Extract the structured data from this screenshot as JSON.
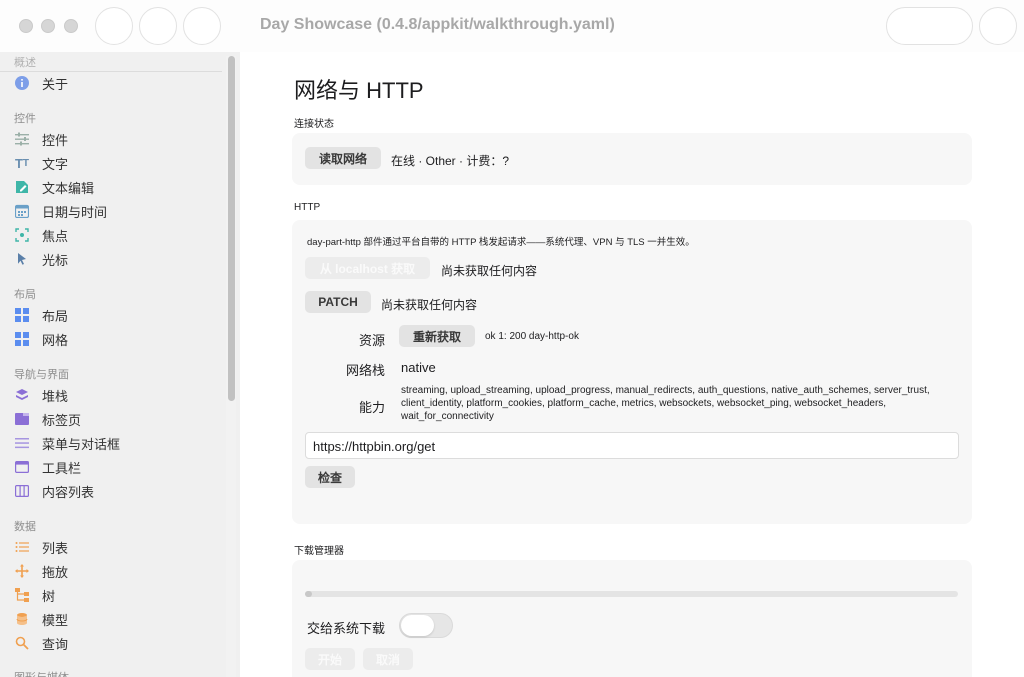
{
  "window": {
    "title": "Day Showcase (0.4.8/appkit/walkthrough.yaml)"
  },
  "sidebar": {
    "sections": [
      {
        "label": "概述"
      },
      {
        "label": "控件"
      },
      {
        "label": "布局"
      },
      {
        "label": "导航与界面"
      },
      {
        "label": "数据"
      },
      {
        "label": "图形与媒体"
      }
    ],
    "items": [
      {
        "label": "关于",
        "icon": "info-icon"
      },
      {
        "label": "控件",
        "icon": "sliders-icon"
      },
      {
        "label": "文字",
        "icon": "text-icon"
      },
      {
        "label": "文本编辑",
        "icon": "edit-doc-icon"
      },
      {
        "label": "日期与时间",
        "icon": "calendar-icon"
      },
      {
        "label": "焦点",
        "icon": "focus-icon"
      },
      {
        "label": "光标",
        "icon": "cursor-icon"
      },
      {
        "label": "布局",
        "icon": "layout-icon"
      },
      {
        "label": "网格",
        "icon": "grid-icon"
      },
      {
        "label": "堆栈",
        "icon": "stack-icon"
      },
      {
        "label": "标签页",
        "icon": "tabs-icon"
      },
      {
        "label": "菜单与对话框",
        "icon": "menu-icon"
      },
      {
        "label": "工具栏",
        "icon": "toolbar-icon"
      },
      {
        "label": "内容列表",
        "icon": "columns-icon"
      },
      {
        "label": "列表",
        "icon": "list-icon"
      },
      {
        "label": "拖放",
        "icon": "move-icon"
      },
      {
        "label": "树",
        "icon": "tree-icon"
      },
      {
        "label": "模型",
        "icon": "database-icon"
      },
      {
        "label": "查询",
        "icon": "search-icon"
      }
    ]
  },
  "main": {
    "title": "网络与 HTTP",
    "connection": {
      "label": "连接状态",
      "read_button": "读取网络",
      "status": "在线 · Other · 计费：?"
    },
    "http": {
      "label": "HTTP",
      "description": "day-part-http 部件通过平台自带的 HTTP 栈发起请求——系统代理、VPN 与 TLS 一并生效。",
      "localhost_button": "从 localhost 获取",
      "localhost_status": "尚未获取任何内容",
      "patch_button": "PATCH",
      "patch_status": "尚未获取任何内容",
      "resource_label": "资源",
      "refetch_button": "重新获取",
      "resource_value": "ok 1: 200 day-http-ok",
      "stack_label": "网络栈",
      "stack_value": "native",
      "capabilities_label": "能力",
      "capabilities_value": "streaming, upload_streaming, upload_progress, manual_redirects, auth_questions, native_auth_schemes, server_trust, client_identity, platform_cookies, platform_cache, metrics, websockets, websocket_ping, websocket_headers, wait_for_connectivity",
      "url_value": "https://httpbin.org/get",
      "inspect_button": "检查"
    },
    "download": {
      "label": "下载管理器",
      "progress": 0.01,
      "handoff_label": "交给系统下载",
      "handoff_enabled": false,
      "start_button": "开始",
      "cancel_button": "取消"
    }
  },
  "colors": {
    "sidebar_bg": "#f0f0f0",
    "panel_bg": "#f7f7f7",
    "icon_blue": "#5b8def",
    "icon_teal": "#3fb6a8",
    "icon_purple": "#8b6fd6",
    "icon_orange": "#f0a050"
  }
}
